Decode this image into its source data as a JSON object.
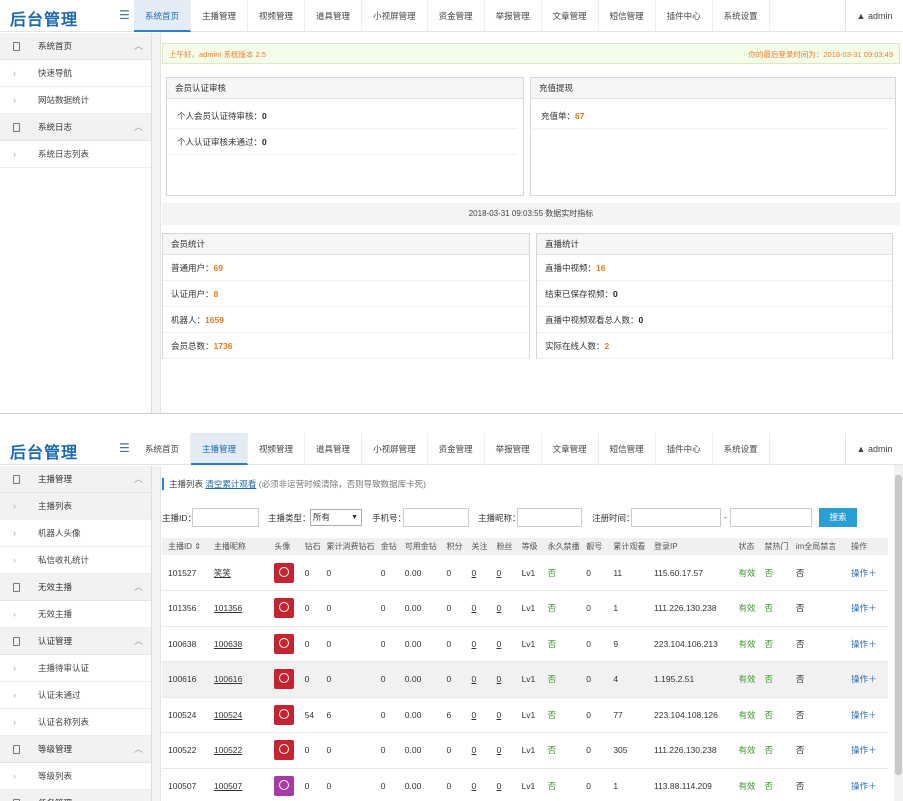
{
  "app": {
    "logo": "后台管理",
    "admin": "admin"
  },
  "panel1": {
    "nav": [
      "系统首页",
      "主播管理",
      "视频管理",
      "道具管理",
      "小视屏管理",
      "资金管理",
      "举报管理",
      "文章管理",
      "短信管理",
      "插件中心",
      "系统设置"
    ],
    "sidebar": [
      {
        "type": "h",
        "label": "系统首页"
      },
      {
        "type": "i",
        "label": "快速导航"
      },
      {
        "type": "i",
        "label": "网站数据统计"
      },
      {
        "type": "h",
        "label": "系统日志"
      },
      {
        "type": "i",
        "label": "系统日志列表"
      }
    ],
    "welcome_left": "上午好，admin! 系统版本 2.5",
    "welcome_right": "你的最后登录时间为：2018-03-31 09:03:49",
    "auth_box": {
      "title": "会员认证审核",
      "rows": [
        {
          "label": "个人会员认证待审核：",
          "value": "0"
        },
        {
          "label": "个人认证审核未通过：",
          "value": "0"
        }
      ]
    },
    "recharge_box": {
      "title": "充值提现",
      "rows": [
        {
          "label": "充值单：",
          "value": "67"
        }
      ]
    },
    "time_bar": "2018-03-31 09:03:55 数据实时指标",
    "member_box": {
      "title": "会员统计",
      "rows": [
        {
          "label": "普通用户：",
          "value": "69"
        },
        {
          "label": "认证用户：",
          "value": "8"
        },
        {
          "label": "机器人：",
          "value": "1659"
        },
        {
          "label": "会员总数：",
          "value": "1736"
        }
      ]
    },
    "live_box": {
      "title": "直播统计",
      "rows": [
        {
          "label": "直播中视频：",
          "value": "16"
        },
        {
          "label": "结束已保存视频：",
          "value": "0"
        },
        {
          "label": "直播中视频观看总人数：",
          "value": "0"
        },
        {
          "label": "实际在线人数：",
          "value": "2"
        }
      ]
    }
  },
  "panel2": {
    "nav": [
      "系统首页",
      "主播管理",
      "视频管理",
      "道具管理",
      "小视屏管理",
      "资金管理",
      "举报管理",
      "文章管理",
      "短信管理",
      "插件中心",
      "系统设置"
    ],
    "sidebar": [
      {
        "type": "h",
        "label": "主播管理"
      },
      {
        "type": "i",
        "label": "主播列表"
      },
      {
        "type": "i",
        "label": "机器人头像"
      },
      {
        "type": "i",
        "label": "私信收礼统计"
      },
      {
        "type": "h",
        "label": "无效主播"
      },
      {
        "type": "i",
        "label": "无效主播"
      },
      {
        "type": "h",
        "label": "认证管理"
      },
      {
        "type": "i",
        "label": "主播待审认证"
      },
      {
        "type": "i",
        "label": "认证未通过"
      },
      {
        "type": "i",
        "label": "认证名称列表"
      },
      {
        "type": "h",
        "label": "等级管理"
      },
      {
        "type": "i",
        "label": "等级列表"
      },
      {
        "type": "h",
        "label": "任务管理"
      }
    ],
    "breadcrumb": {
      "label": "主播列表",
      "link": "清空累计观看",
      "note": "(必须非运营时候清除，否则导致数据库卡死)"
    },
    "filters": {
      "id_label": "主播ID：",
      "type_label": "主播类型：",
      "type_value": "所有",
      "phone_label": "手机号：",
      "nick_label": "主播昵称：",
      "time_label": "注册时间：",
      "dash": "-",
      "search": "搜索"
    },
    "columns": [
      "主播ID ⇕",
      "主播昵称",
      "头像",
      "钻石",
      "累计消费钻石数",
      "金钻",
      "可用金钻",
      "积分",
      "关注",
      "粉丝",
      "等级",
      "永久禁播",
      "靓号",
      "累计观看",
      "登录IP",
      "状态",
      "禁热门",
      "im全局禁言",
      "操作"
    ],
    "rows": [
      [
        "101527",
        "笑笑",
        "",
        "0",
        "0",
        "0",
        "0.00",
        "0",
        "0",
        "0",
        "Lv1",
        "否",
        "0",
        "11",
        "115.60.17.57",
        "有效",
        "否",
        "否",
        "操作＋"
      ],
      [
        "101356",
        "101356",
        "",
        "0",
        "0",
        "0",
        "0.00",
        "0",
        "0",
        "0",
        "Lv1",
        "否",
        "0",
        "1",
        "111.226.130.238",
        "有效",
        "否",
        "否",
        "操作＋"
      ],
      [
        "100638",
        "100638",
        "",
        "0",
        "0",
        "0",
        "0.00",
        "0",
        "0",
        "0",
        "Lv1",
        "否",
        "0",
        "9",
        "223.104.106.213",
        "有效",
        "否",
        "否",
        "操作＋"
      ],
      [
        "100616",
        "100616",
        "",
        "0",
        "0",
        "0",
        "0.00",
        "0",
        "0",
        "0",
        "Lv1",
        "否",
        "0",
        "4",
        "1.195.2.51",
        "有效",
        "否",
        "否",
        "操作＋"
      ],
      [
        "100524",
        "100524",
        "",
        "54",
        "6",
        "0",
        "0.00",
        "6",
        "0",
        "0",
        "Lv1",
        "否",
        "0",
        "77",
        "223.104.108.126",
        "有效",
        "否",
        "否",
        "操作＋"
      ],
      [
        "100522",
        "100522",
        "",
        "0",
        "0",
        "0",
        "0.00",
        "0",
        "0",
        "0",
        "Lv1",
        "否",
        "0",
        "305",
        "111.226.130.238",
        "有效",
        "否",
        "否",
        "操作＋"
      ],
      [
        "100507",
        "100507",
        "",
        "0",
        "0",
        "0",
        "0.00",
        "0",
        "0",
        "0",
        "Lv1",
        "否",
        "0",
        "1",
        "113.88.114.209",
        "有效",
        "否",
        "否",
        "操作＋"
      ]
    ]
  }
}
